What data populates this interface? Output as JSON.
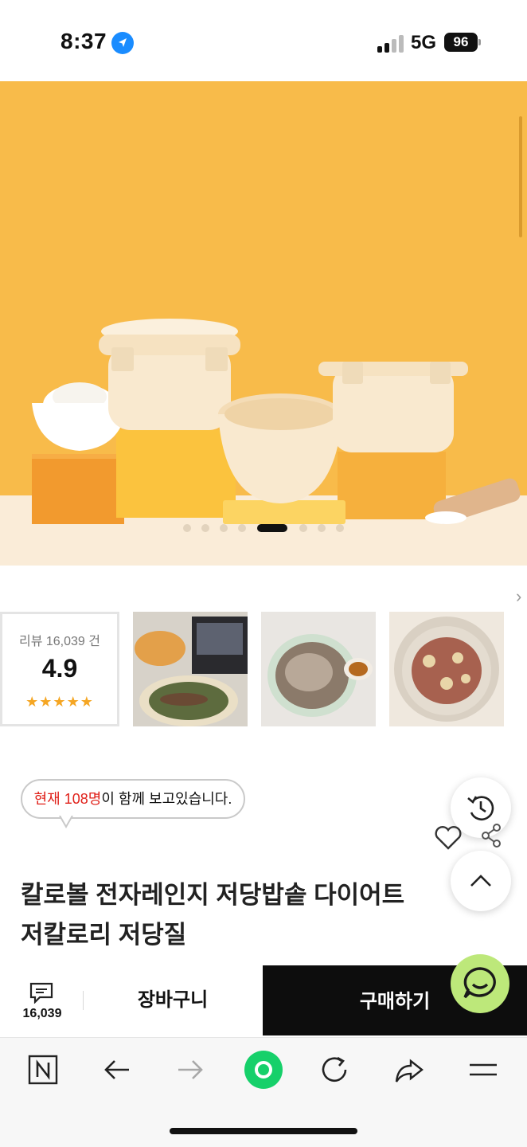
{
  "status_bar": {
    "time": "8:37",
    "network": "5G",
    "battery": "96"
  },
  "hero": {
    "slide_count": 9,
    "active_slide_index": 4
  },
  "reviews": {
    "count_label": "리뷰 16,039 건",
    "score": "4.9",
    "stars": "★★★★★",
    "star_rating": 5
  },
  "viewers": {
    "prefix": "현재 108명",
    "suffix": "이 함께 보고있습니다."
  },
  "product": {
    "title_line1": "칼로볼 전자레인지 저당밥솥 다이어트",
    "title_line2": "저칼로리 저당질"
  },
  "purchase_bar": {
    "chat_count": "16,039",
    "cart_label": "장바구니",
    "buy_label": "구매하기"
  },
  "colors": {
    "hero_bg": "#f8bb4a",
    "buy_bg": "#0d0d0d",
    "talk_bg": "#bde87a",
    "refresh_green": "#16d06a",
    "viewers_red": "#e0211a",
    "star": "#f5a623"
  },
  "icons": {
    "toolbar": [
      "naver-n-icon",
      "back-arrow-icon",
      "forward-arrow-icon",
      "green-dot-icon",
      "reload-icon",
      "share-icon",
      "menu-icon"
    ]
  }
}
